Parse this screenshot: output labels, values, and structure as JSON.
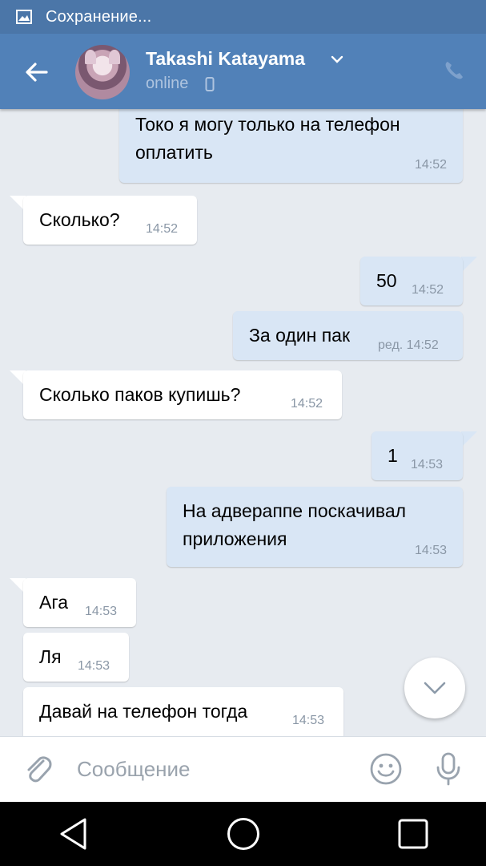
{
  "status_bar": {
    "text": "Сохранение...",
    "icon": "image-icon"
  },
  "header": {
    "contact_name": "Takashi Katayama",
    "presence": "online",
    "accent": "#5181b8"
  },
  "messages": [
    {
      "dir": "out",
      "text_lines": [
        "Токо я могу только на телефон",
        "оплатить"
      ],
      "time": "14:52"
    },
    {
      "dir": "in",
      "text": "Сколько?",
      "time": "14:52"
    },
    {
      "dir": "out",
      "text": "50",
      "time": "14:52"
    },
    {
      "dir": "out",
      "text": "За один пак",
      "time": "ред. 14:52"
    },
    {
      "dir": "in",
      "text": "Сколько паков купишь?",
      "time": "14:52"
    },
    {
      "dir": "out",
      "text": "1",
      "time": "14:53"
    },
    {
      "dir": "out",
      "text_lines": [
        "На адвераппе поскачивал",
        "приложения"
      ],
      "time": "14:53"
    },
    {
      "dir": "in",
      "text": "Ага",
      "time": "14:53"
    },
    {
      "dir": "in",
      "text": "Ля",
      "time": "14:53"
    },
    {
      "dir": "in",
      "text": "Давай на телефон тогда",
      "time": "14:53"
    }
  ],
  "composer": {
    "placeholder": "Сообщение"
  },
  "colors": {
    "incoming": "#ffffff",
    "outgoing": "#d9e6f5",
    "background": "#e7ebf0"
  }
}
